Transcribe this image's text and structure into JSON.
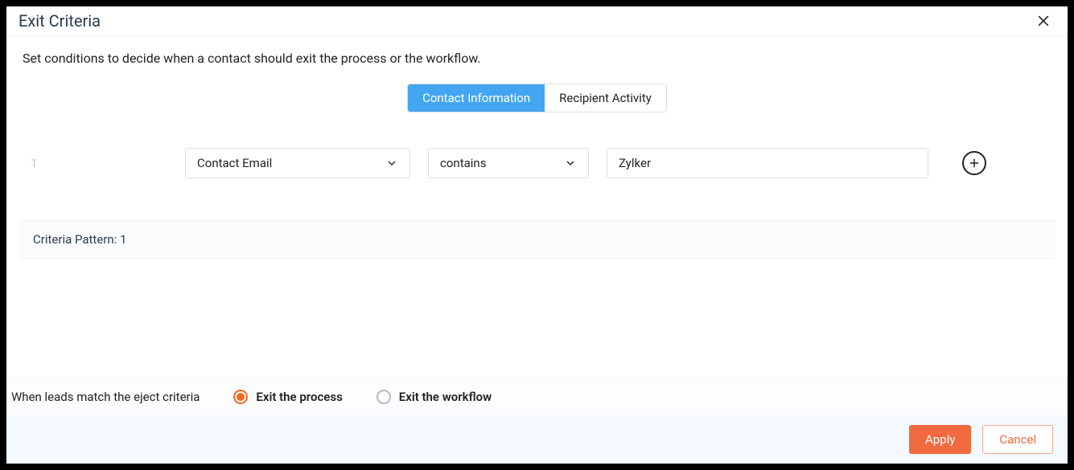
{
  "header": {
    "title": "Exit Criteria"
  },
  "description": "Set conditions to decide when a contact should exit the process or the workflow.",
  "tabs": {
    "contact_info": "Contact Information",
    "recipient_activity": "Recipient Activity"
  },
  "criteria": {
    "rows": [
      {
        "index": "1",
        "field": "Contact Email",
        "operator": "contains",
        "value": "Zylker"
      }
    ]
  },
  "pattern": {
    "label": "Criteria Pattern: ",
    "value": "1"
  },
  "radio": {
    "prompt": "When leads match the eject criteria",
    "opt_process": "Exit the process",
    "opt_workflow": "Exit the workflow",
    "selected": "process"
  },
  "footer": {
    "apply": "Apply",
    "cancel": "Cancel"
  }
}
